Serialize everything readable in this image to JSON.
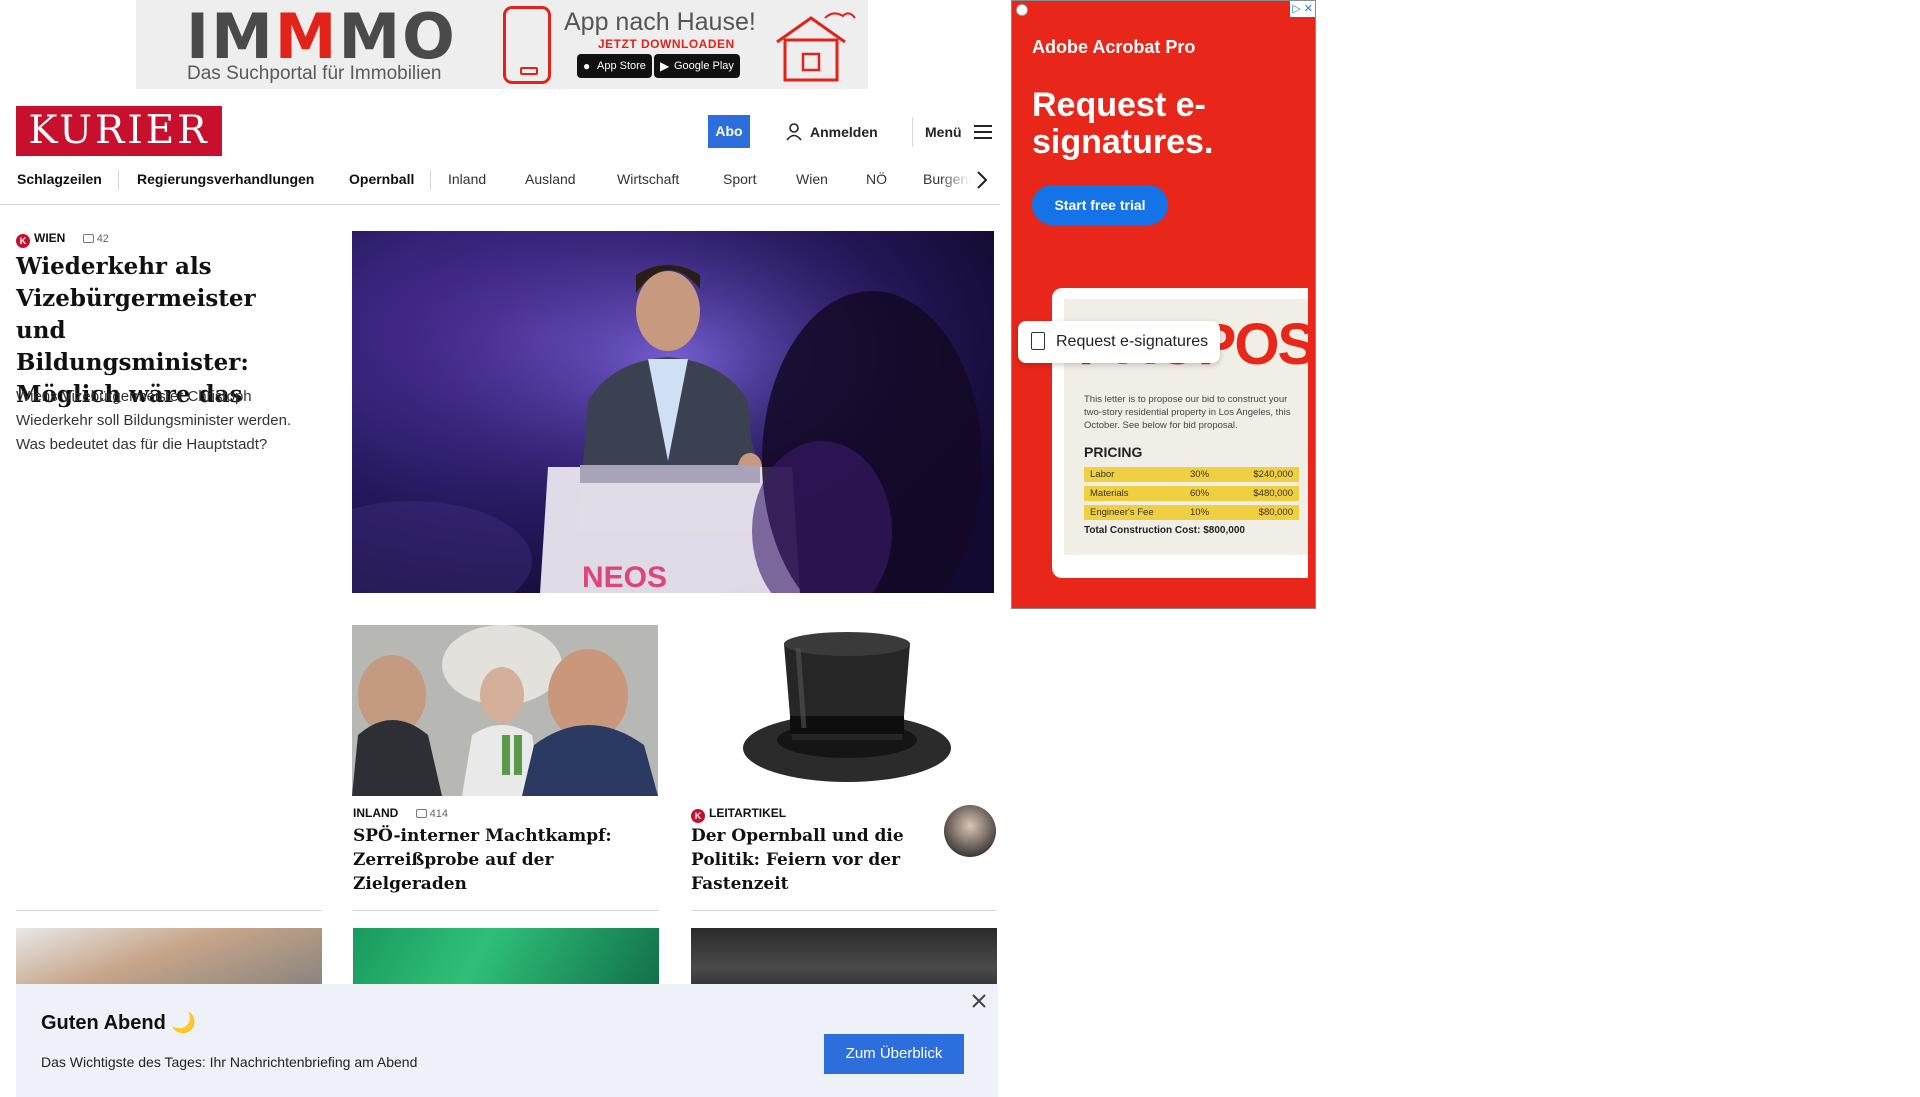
{
  "top_ad": {
    "brand_left": "IM",
    "brand_red": "M",
    "brand_right": "MO",
    "subtitle": "Das Suchportal für Immobilien",
    "headline": "App nach Hause!",
    "cta": "JETZT DOWNLOADEN",
    "app_store": "App Store",
    "google_play": "Google Play",
    "colors": {
      "brand_red": "#e2231a",
      "brand_grey": "#4a4a4a"
    }
  },
  "header": {
    "logo": "KURIER",
    "abo": "Abo",
    "login": "Anmelden",
    "menu": "Menü",
    "colors": {
      "logo_red": "#c8102e",
      "accent_blue": "#2c6fdc"
    }
  },
  "nav": {
    "items": [
      "Schlagzeilen",
      "Regierungsverhandlungen",
      "Opernball",
      "Inland",
      "Ausland",
      "Wirtschaft",
      "Sport",
      "Wien",
      "NÖ",
      "Burgenland"
    ]
  },
  "lead": {
    "section": "WIEN",
    "comments": "42",
    "headline": "Wiederkehr als Vizebürgermeister und Bildungsminister: Möglich wäre das",
    "teaser": "Wiens Vizebürgermeister Christoph Wiederkehr soll Bildungsminister werden. Was bedeutet das für die Hauptstadt?",
    "image_text": "NEOS"
  },
  "cards": [
    {
      "section": "INLAND",
      "comments": "414",
      "headline": "SPÖ-interner Machtkampf: Zerreißprobe auf der Zielgeraden"
    },
    {
      "section": "LEITARTIKEL",
      "headline": "Der Opernball und die Politik: Feiern vor der Fastenzeit"
    }
  ],
  "side_ad": {
    "brand": "Adobe Acrobat Pro",
    "headline": "Request e-signatures.",
    "cta": "Start free trial",
    "pill": "Request e-signatures",
    "doc_title": "PROPOSAL",
    "doc_text": "This letter is to propose our bid to construct your two-story residential property in Los Angeles, this October. See below for bid proposal.",
    "pricing_label": "PRICING",
    "rows": [
      {
        "item": "Labor",
        "pct": "30%",
        "amount": "$240,000"
      },
      {
        "item": "Materials",
        "pct": "60%",
        "amount": "$480,000"
      },
      {
        "item": "Engineer's Fee",
        "pct": "10%",
        "amount": "$80,000"
      }
    ],
    "total": "Total Construction Cost: $800,000",
    "colors": {
      "background": "#e8271a",
      "button": "#1473e6"
    }
  },
  "briefing": {
    "title": "Guten Abend 🌙",
    "text": "Das Wichtigste des Tages: Ihr Nachrichtenbriefing am Abend",
    "button": "Zum Überblick"
  }
}
